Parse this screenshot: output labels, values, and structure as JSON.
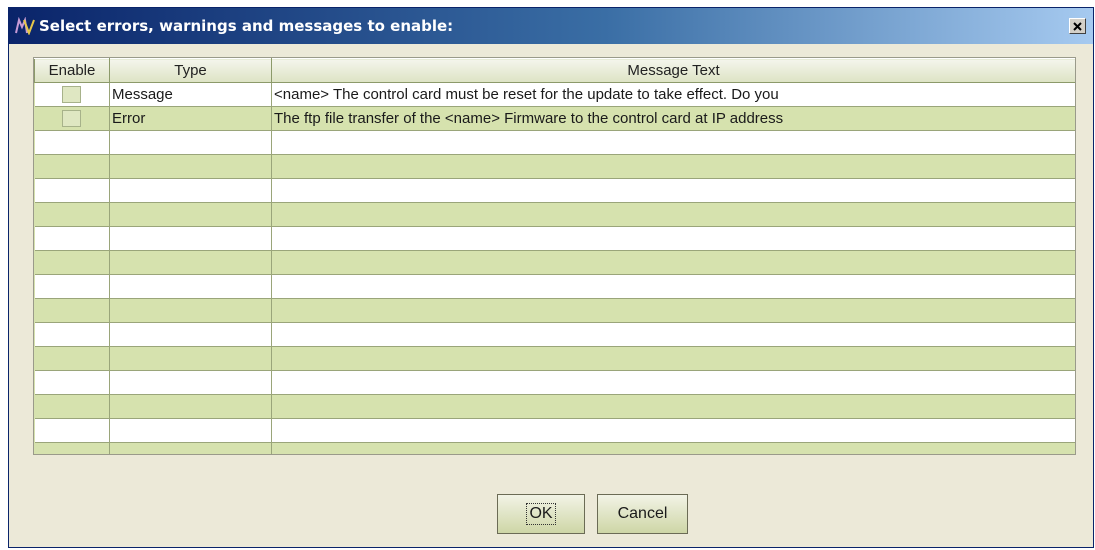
{
  "window": {
    "title": "Select errors, warnings and messages to enable:",
    "app_icon": "mv-logo-icon",
    "close_icon": "close-icon"
  },
  "table": {
    "headers": [
      "Enable",
      "Type",
      "Message Text"
    ],
    "rows": [
      {
        "enabled": false,
        "type": "Message",
        "text": "<name>  The control card must be reset for the update to take effect. Do you"
      },
      {
        "enabled": false,
        "type": "Error",
        "text": "The ftp file transfer of the <name> Firmware to the control card at IP address"
      }
    ],
    "empty_rows": 14,
    "colors": {
      "header": "#e8ecd6",
      "row_odd": "#ffffff",
      "row_even": "#d6e2ae",
      "grid": "#9aa57a"
    }
  },
  "buttons": {
    "ok": "OK",
    "cancel": "Cancel"
  }
}
